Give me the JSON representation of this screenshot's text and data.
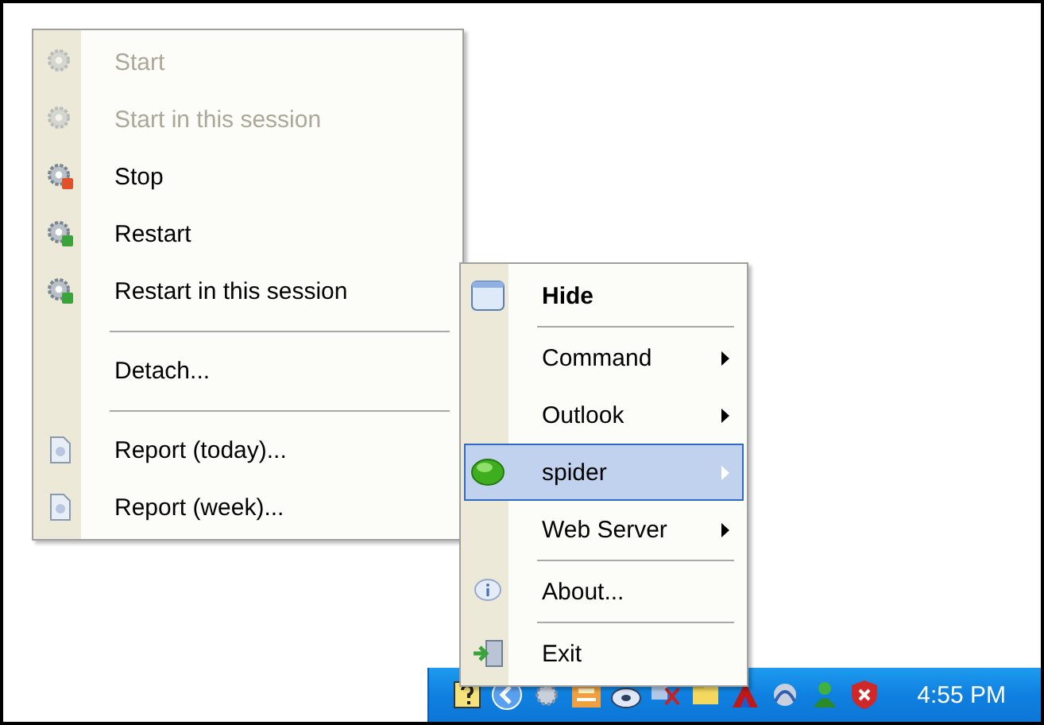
{
  "service_menu": {
    "items": [
      {
        "kind": "item",
        "label": "Start",
        "disabled": true
      },
      {
        "kind": "item",
        "label": "Start in this session",
        "disabled": true
      },
      {
        "kind": "item",
        "label": "Stop",
        "disabled": false
      },
      {
        "kind": "item",
        "label": "Restart",
        "disabled": false
      },
      {
        "kind": "item",
        "label": "Restart in this session",
        "disabled": false
      },
      {
        "kind": "separator"
      },
      {
        "kind": "item",
        "label": "Detach...",
        "disabled": false
      },
      {
        "kind": "separator"
      },
      {
        "kind": "item",
        "label": "Report (today)...",
        "disabled": false
      },
      {
        "kind": "item",
        "label": "Report (week)...",
        "disabled": false
      }
    ]
  },
  "tray_menu": {
    "items": [
      {
        "kind": "item",
        "label": "Hide",
        "default": true,
        "submenu": false,
        "selected": false
      },
      {
        "kind": "separator"
      },
      {
        "kind": "item",
        "label": "Command",
        "default": false,
        "submenu": true,
        "selected": false
      },
      {
        "kind": "item",
        "label": "Outlook",
        "default": false,
        "submenu": true,
        "selected": false
      },
      {
        "kind": "item",
        "label": "spider",
        "default": false,
        "submenu": true,
        "selected": true
      },
      {
        "kind": "item",
        "label": "Web Server",
        "default": false,
        "submenu": true,
        "selected": false
      },
      {
        "kind": "separator"
      },
      {
        "kind": "item",
        "label": "About...",
        "default": false,
        "submenu": false,
        "selected": false
      },
      {
        "kind": "separator"
      },
      {
        "kind": "item",
        "label": "Exit",
        "default": false,
        "submenu": false,
        "selected": false
      }
    ]
  },
  "taskbar": {
    "clock": "4:55 PM"
  }
}
